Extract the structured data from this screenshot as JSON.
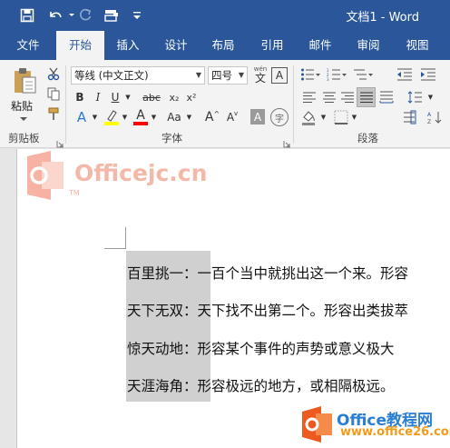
{
  "titlebar": {
    "title": "文档1 - Word",
    "qat_icons": [
      "save-icon",
      "undo-icon",
      "redo-icon",
      "touch-mode-icon",
      "customize-qat-icon"
    ]
  },
  "tabs": [
    {
      "label": "文件",
      "active": false
    },
    {
      "label": "开始",
      "active": true
    },
    {
      "label": "插入",
      "active": false
    },
    {
      "label": "设计",
      "active": false
    },
    {
      "label": "布局",
      "active": false
    },
    {
      "label": "引用",
      "active": false
    },
    {
      "label": "邮件",
      "active": false
    },
    {
      "label": "审阅",
      "active": false
    },
    {
      "label": "视图",
      "active": false
    }
  ],
  "ribbon": {
    "clipboard": {
      "paste_label": "粘贴",
      "group_label": "剪贴板"
    },
    "font": {
      "font_name": "等线 (中文正文)",
      "font_size": "四号",
      "phonetic_top": "wén",
      "phonetic_char": "文",
      "char_border": "A",
      "bold": "B",
      "italic": "I",
      "underline": "U",
      "strikethrough": "abc",
      "subscript": "x₂",
      "superscript": "x²",
      "text_effects": "A",
      "font_color_letter": "A",
      "change_case": "Aa",
      "grow": "A",
      "shrink": "A",
      "char_shading": "A",
      "enclose_char": "字",
      "group_label": "字体"
    },
    "paragraph": {
      "group_label": "段落"
    },
    "colors": {
      "highlight": "#ffff00",
      "font_color": "#ff0000",
      "accent": "#2b579a"
    }
  },
  "document": {
    "lines": [
      "百里挑一：一百个当中就挑出这一个来。形容",
      "天下无双：天下找不出第二个。形容出类拔萃",
      "惊天动地：形容某个事件的声势或意义极大",
      "天涯海角：形容极远的地方，或相隔极远。"
    ]
  },
  "watermarks": {
    "site1": "Officejc.cn",
    "site1_tm": "TM",
    "site2": "Office教程网",
    "site2_url": "www.office26.com"
  }
}
